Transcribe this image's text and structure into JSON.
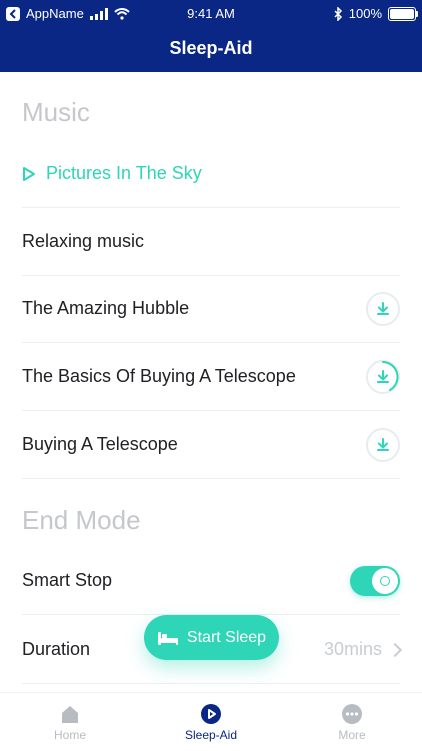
{
  "status_bar": {
    "app_name": "AppName",
    "time": "9:41 AM",
    "battery": "100%"
  },
  "header": {
    "title": "Sleep-Aid"
  },
  "music": {
    "section_title": "Music",
    "tracks": [
      {
        "label": "Pictures In The Sky",
        "state": "playing"
      },
      {
        "label": "Relaxing music",
        "state": "none"
      },
      {
        "label": "The Amazing Hubble",
        "state": "download"
      },
      {
        "label": "The Basics Of Buying A Telescope",
        "state": "downloading"
      },
      {
        "label": "Buying A Telescope",
        "state": "download"
      }
    ]
  },
  "end_mode": {
    "section_title": "End Mode",
    "smart_stop": {
      "label": "Smart Stop",
      "enabled": true
    },
    "duration": {
      "label": "Duration",
      "value": "30mins"
    }
  },
  "start_button": {
    "label": "Start Sleep"
  },
  "tabs": [
    {
      "label": "Home",
      "icon": "home-icon",
      "active": false
    },
    {
      "label": "Sleep-Aid",
      "icon": "play-circle-icon",
      "active": true
    },
    {
      "label": "More",
      "icon": "more-dots-icon",
      "active": false
    }
  ],
  "colors": {
    "header_bg": "#0a2785",
    "accent": "#2ed5b7",
    "muted": "#c5c7cc"
  }
}
